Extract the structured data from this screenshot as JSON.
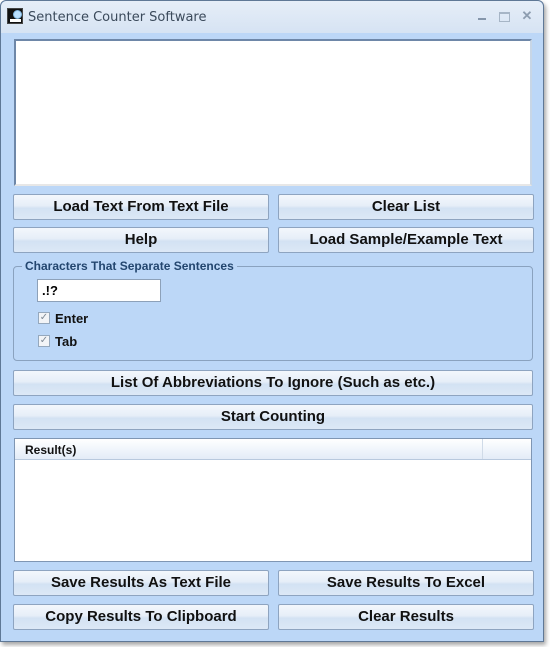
{
  "window": {
    "title": "Sentence Counter Software",
    "icon": "magnifier-app-icon",
    "controls": {
      "minimize": "minimize-icon",
      "maximize": "maximize-icon",
      "close": "close-icon",
      "close_glyph": "✕"
    }
  },
  "input": {
    "text": ""
  },
  "buttons": {
    "load_text": "Load Text From Text File",
    "clear_list": "Clear List",
    "help": "Help",
    "load_sample": "Load Sample/Example Text",
    "abbreviations": "List Of Abbreviations To Ignore (Such as etc.)",
    "start_counting": "Start Counting",
    "save_text": "Save Results As Text File",
    "save_excel": "Save Results To Excel",
    "copy_clipboard": "Copy Results To Clipboard",
    "clear_results": "Clear Results"
  },
  "separators": {
    "group_label": "Characters That Separate Sentences",
    "characters": ".!?",
    "enter": {
      "label": "Enter",
      "checked": true,
      "check_glyph": "✓"
    },
    "tab": {
      "label": "Tab",
      "checked": true,
      "check_glyph": "✓"
    }
  },
  "results": {
    "columns": [
      "Result(s)",
      ""
    ],
    "rows": []
  }
}
